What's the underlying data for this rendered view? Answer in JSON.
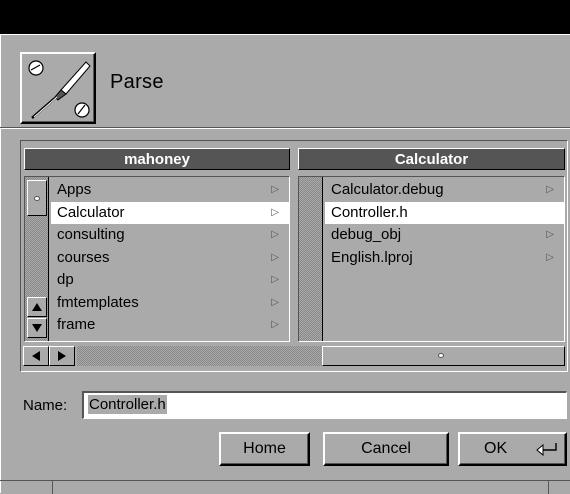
{
  "panel": {
    "title": "Parse",
    "icon": "screwdriver-icon"
  },
  "browser": {
    "columns": [
      {
        "title": "mahoney",
        "items": [
          {
            "label": "Apps",
            "branch": true,
            "selected": false
          },
          {
            "label": "Calculator",
            "branch": true,
            "selected": true
          },
          {
            "label": "consulting",
            "branch": true,
            "selected": false
          },
          {
            "label": "courses",
            "branch": true,
            "selected": false
          },
          {
            "label": "dp",
            "branch": true,
            "selected": false
          },
          {
            "label": "fmtemplates",
            "branch": true,
            "selected": false
          },
          {
            "label": "frame",
            "branch": true,
            "selected": false
          }
        ]
      },
      {
        "title": "Calculator",
        "items": [
          {
            "label": "Calculator.debug",
            "branch": true,
            "selected": false
          },
          {
            "label": "Controller.h",
            "branch": false,
            "selected": true
          },
          {
            "label": "debug_obj",
            "branch": true,
            "selected": false
          },
          {
            "label": "English.lproj",
            "branch": true,
            "selected": false
          }
        ]
      }
    ],
    "branch_glyph": "▷"
  },
  "name_field": {
    "label": "Name:",
    "value": "Controller.h"
  },
  "buttons": {
    "home": "Home",
    "cancel": "Cancel",
    "ok": "OK"
  },
  "colors": {
    "background": "#aaaaaa",
    "title_bar": "#000000",
    "column_title": "#555555",
    "selection": "#ffffff"
  }
}
